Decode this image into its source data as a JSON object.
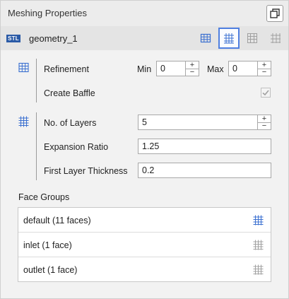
{
  "panel": {
    "title": "Meshing Properties",
    "popout_icon": "popout-window-icon"
  },
  "geometry": {
    "badge": "STL",
    "name": "geometry_1",
    "mode_icons": [
      "surface-grid-icon",
      "volume-grid-icon",
      "layer-grid-icon",
      "cell-grid-icon"
    ],
    "active_mode": 1
  },
  "refinement": {
    "icon": "surface-grid-icon",
    "label": "Refinement",
    "min_label": "Min",
    "min_value": "0",
    "max_label": "Max",
    "max_value": "0",
    "baffle_label": "Create Baffle",
    "baffle_checked": true
  },
  "layers": {
    "icon": "volume-grid-icon",
    "num_layers_label": "No. of Layers",
    "num_layers_value": "5",
    "expansion_label": "Expansion Ratio",
    "expansion_value": "1.25",
    "first_layer_label": "First Layer Thickness",
    "first_layer_value": "0.2"
  },
  "face_groups": {
    "title": "Face Groups",
    "items": [
      {
        "label": "default  (11 faces)",
        "icon_active": true
      },
      {
        "label": "inlet  (1 face)",
        "icon_active": false
      },
      {
        "label": "outlet  (1 face)",
        "icon_active": false
      }
    ]
  },
  "colors": {
    "accent": "#4f7fe0",
    "icon_blue": "#3a6fd0",
    "icon_gray": "#a0a0a0"
  }
}
